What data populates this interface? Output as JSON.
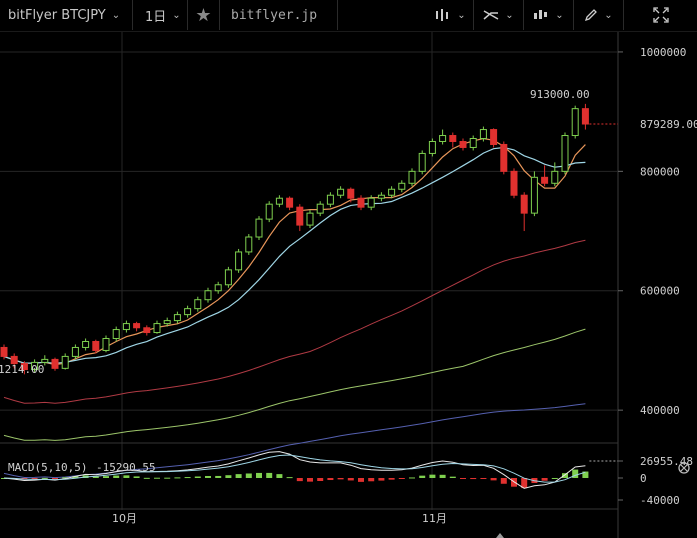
{
  "toolbar": {
    "symbol": "bitFlyer BTCJPY",
    "interval": "1日",
    "site": "bitflyer.jp"
  },
  "price_axis": {
    "ticks": [
      {
        "value": 1000000,
        "label": "1000000"
      },
      {
        "value": 800000,
        "label": "800000"
      },
      {
        "value": 600000,
        "label": "600000"
      },
      {
        "value": 400000,
        "label": "400000"
      }
    ],
    "last_price_label": "879289.00",
    "high_label": "913000.00",
    "low_label": "1214.00"
  },
  "macd": {
    "label": "MACD(5,10,5)",
    "value": "-15290.55",
    "axis_labels": [
      "26955.48",
      "0",
      "-40000"
    ]
  },
  "time_axis": [
    "10月",
    "11月"
  ],
  "colors": {
    "up": "#7fd04f",
    "down": "#e0312f",
    "ma5": "#e8965a",
    "ma10": "#9fd6e6",
    "ma30": "#b03a44",
    "ma60": "#9cc56a",
    "ma120": "#5560b0",
    "grid": "#262626"
  },
  "chart_data": {
    "type": "candlestick",
    "ylim": [
      350000,
      1020000
    ],
    "candles": [
      [
        505000,
        490000,
        510000,
        485000
      ],
      [
        490000,
        478000,
        495000,
        470000
      ],
      [
        478000,
        468000,
        482000,
        460000
      ],
      [
        468000,
        480000,
        485000,
        463000
      ],
      [
        480000,
        485000,
        492000,
        475000
      ],
      [
        485000,
        470000,
        488000,
        466000
      ],
      [
        470000,
        490000,
        495000,
        468000
      ],
      [
        490000,
        505000,
        510000,
        485000
      ],
      [
        505000,
        515000,
        520000,
        500000
      ],
      [
        515000,
        500000,
        518000,
        495000
      ],
      [
        500000,
        520000,
        525000,
        497000
      ],
      [
        520000,
        535000,
        540000,
        515000
      ],
      [
        535000,
        545000,
        550000,
        530000
      ],
      [
        545000,
        538000,
        548000,
        532000
      ],
      [
        538000,
        530000,
        542000,
        525000
      ],
      [
        530000,
        545000,
        550000,
        528000
      ],
      [
        545000,
        550000,
        555000,
        540000
      ],
      [
        550000,
        560000,
        565000,
        545000
      ],
      [
        560000,
        570000,
        575000,
        555000
      ],
      [
        570000,
        585000,
        590000,
        565000
      ],
      [
        585000,
        600000,
        605000,
        580000
      ],
      [
        600000,
        610000,
        615000,
        595000
      ],
      [
        610000,
        635000,
        640000,
        605000
      ],
      [
        635000,
        665000,
        670000,
        630000
      ],
      [
        665000,
        690000,
        695000,
        660000
      ],
      [
        690000,
        720000,
        725000,
        685000
      ],
      [
        720000,
        745000,
        750000,
        715000
      ],
      [
        745000,
        755000,
        760000,
        740000
      ],
      [
        755000,
        740000,
        758000,
        735000
      ],
      [
        740000,
        710000,
        745000,
        700000
      ],
      [
        710000,
        730000,
        735000,
        705000
      ],
      [
        730000,
        745000,
        750000,
        725000
      ],
      [
        745000,
        760000,
        765000,
        740000
      ],
      [
        760000,
        770000,
        775000,
        755000
      ],
      [
        770000,
        755000,
        773000,
        748000
      ],
      [
        755000,
        740000,
        760000,
        735000
      ],
      [
        740000,
        755000,
        760000,
        735000
      ],
      [
        755000,
        760000,
        765000,
        750000
      ],
      [
        760000,
        770000,
        775000,
        755000
      ],
      [
        770000,
        780000,
        785000,
        765000
      ],
      [
        780000,
        800000,
        805000,
        775000
      ],
      [
        800000,
        830000,
        835000,
        795000
      ],
      [
        830000,
        850000,
        855000,
        825000
      ],
      [
        850000,
        860000,
        870000,
        845000
      ],
      [
        860000,
        850000,
        865000,
        840000
      ],
      [
        850000,
        840000,
        855000,
        835000
      ],
      [
        840000,
        855000,
        860000,
        835000
      ],
      [
        855000,
        870000,
        875000,
        850000
      ],
      [
        870000,
        845000,
        872000,
        840000
      ],
      [
        845000,
        800000,
        850000,
        795000
      ],
      [
        800000,
        760000,
        805000,
        755000
      ],
      [
        760000,
        730000,
        765000,
        700000
      ],
      [
        730000,
        790000,
        800000,
        725000
      ],
      [
        790000,
        780000,
        810000,
        775000
      ],
      [
        780000,
        800000,
        815000,
        775000
      ],
      [
        800000,
        860000,
        865000,
        795000
      ],
      [
        860000,
        905000,
        910000,
        855000
      ],
      [
        905000,
        879289,
        913000,
        870000
      ]
    ]
  }
}
